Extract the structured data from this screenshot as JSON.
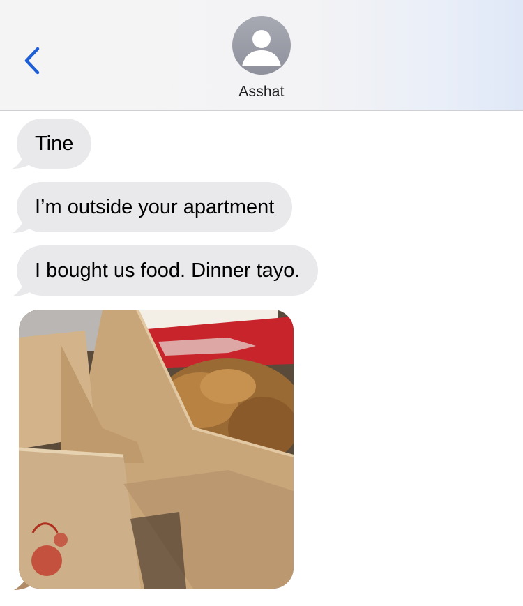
{
  "header": {
    "back_icon": "chevron-left-icon",
    "avatar_icon": "person-silhouette-icon",
    "contact_name": "Asshat"
  },
  "messages": [
    {
      "direction": "incoming",
      "type": "text",
      "text": "Tine"
    },
    {
      "direction": "incoming",
      "type": "text",
      "text": "I’m outside your apartment"
    },
    {
      "direction": "incoming",
      "type": "text",
      "text": "I bought us food. Dinner tayo."
    },
    {
      "direction": "incoming",
      "type": "image",
      "description_icon": "food-bags-photo"
    }
  ],
  "colors": {
    "accent": "#1f5fd6",
    "incoming_bubble": "#e9e9eb",
    "header_bg": "#f4f4f5"
  }
}
